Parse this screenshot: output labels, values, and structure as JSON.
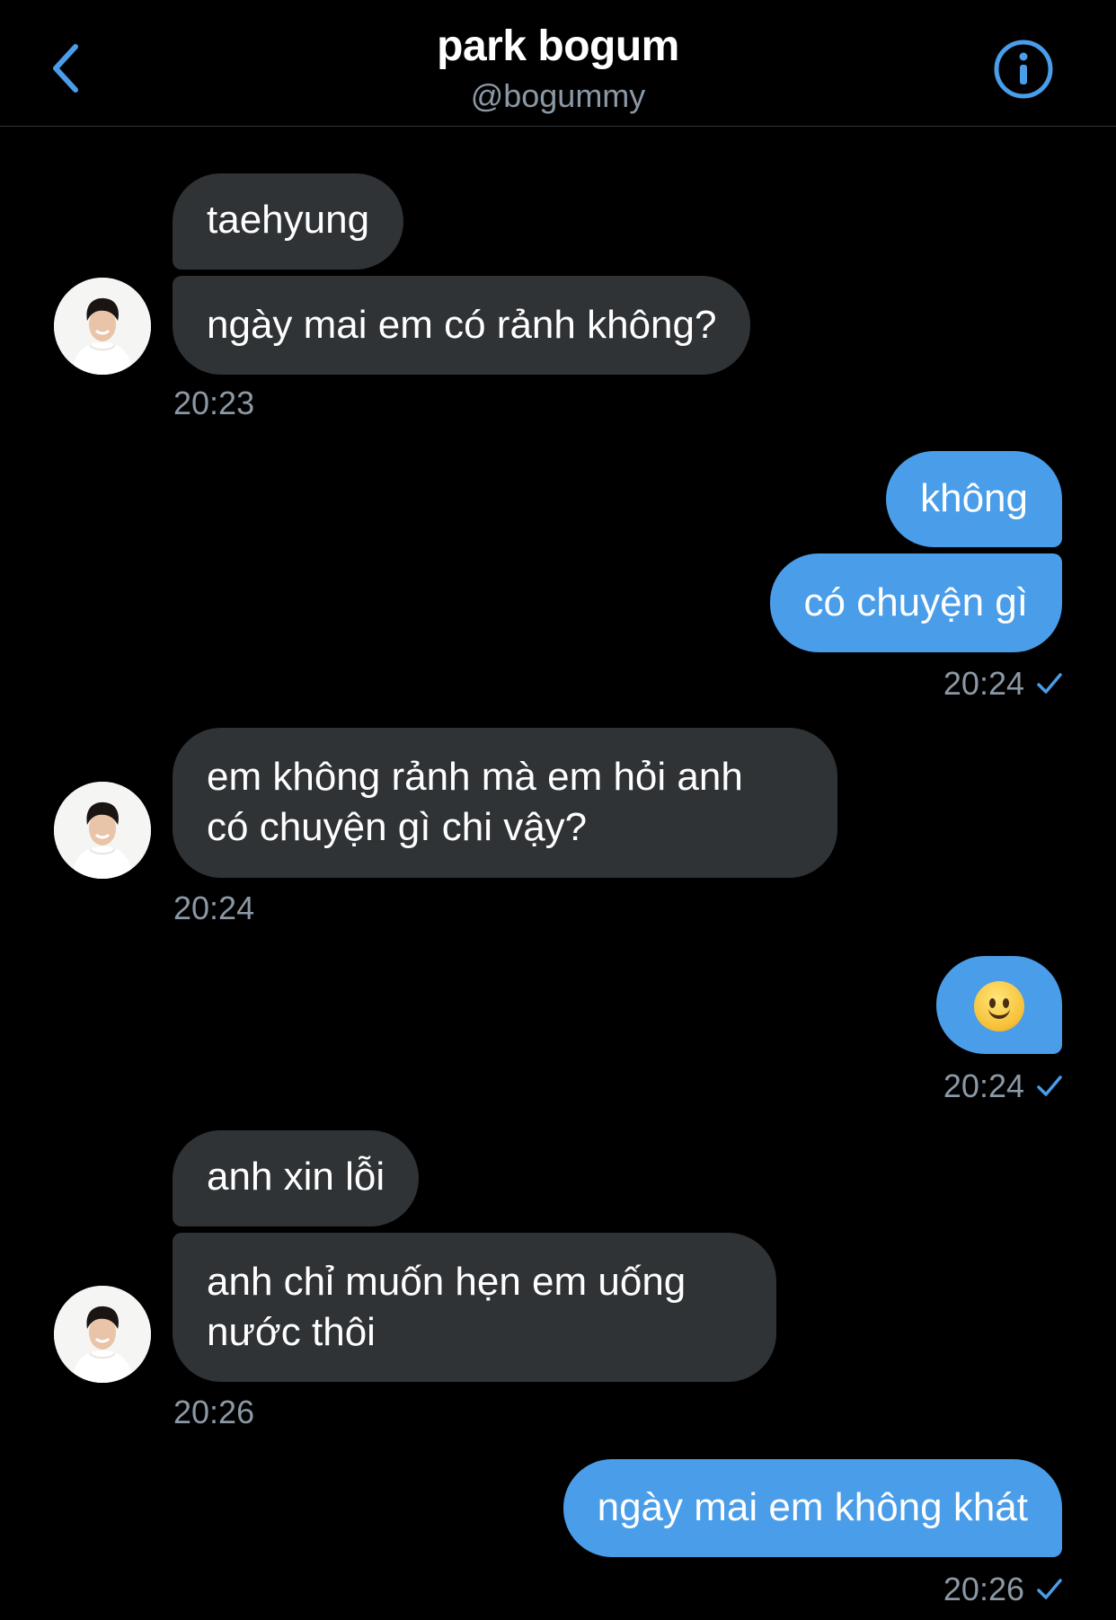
{
  "header": {
    "title": "park bogum",
    "handle": "@bogummy",
    "accent_color": "#4a9de8",
    "back_icon": "chevron-left-icon",
    "info_icon": "info-icon"
  },
  "messages": [
    {
      "sender": "them",
      "text": "taehyung"
    },
    {
      "sender": "them",
      "text": "ngày mai em có rảnh không?"
    },
    {
      "sender": "me",
      "text": "không"
    },
    {
      "sender": "me",
      "text": "có chuyện gì"
    },
    {
      "sender": "them",
      "line1": "em không rảnh mà em hỏi anh",
      "line2": "có chuyện gì chi vậy?"
    },
    {
      "sender": "me",
      "emoji": "slightly-smiling-face"
    },
    {
      "sender": "them",
      "text": "anh xin lỗi"
    },
    {
      "sender": "them",
      "line1": "anh chỉ muốn hẹn em uống",
      "line2": "nước thôi"
    },
    {
      "sender": "me",
      "text": "ngày mai em không khát"
    }
  ],
  "timestamps": {
    "t1": "20:23",
    "t2": "20:24",
    "t3": "20:24",
    "t4": "20:24",
    "t5": "20:26",
    "t6": "20:26"
  }
}
